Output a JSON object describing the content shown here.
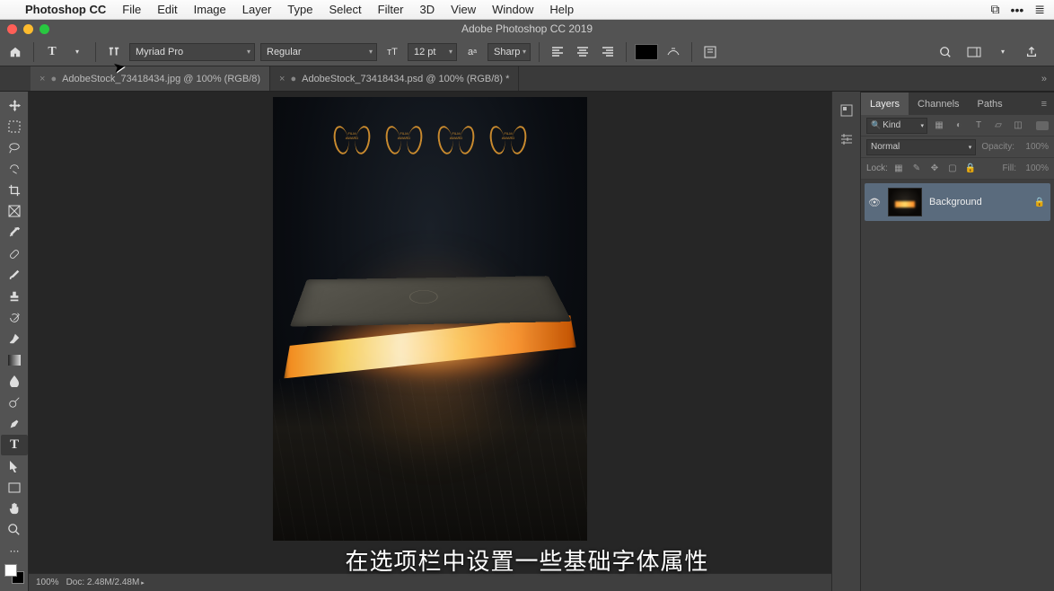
{
  "mac_menu": {
    "app": "Photoshop CC",
    "items": [
      "File",
      "Edit",
      "Image",
      "Layer",
      "Type",
      "Select",
      "Filter",
      "3D",
      "View",
      "Window",
      "Help"
    ]
  },
  "window_title": "Adobe Photoshop CC 2019",
  "options_bar": {
    "font_family": "Myriad Pro",
    "font_style": "Regular",
    "font_size": "12 pt",
    "antialias": "Sharp",
    "color_swatch": "#000000"
  },
  "doc_tabs": [
    {
      "label": "AdobeStock_73418434.jpg @ 100% (RGB/8)",
      "active": true
    },
    {
      "label": "AdobeStock_73418434.psd @ 100% (RGB/8) *",
      "active": false
    }
  ],
  "status_bar": {
    "zoom": "100%",
    "doc_info": "Doc: 2.48M/2.48M"
  },
  "layers_panel": {
    "tabs": [
      "Layers",
      "Channels",
      "Paths"
    ],
    "active_tab": 0,
    "filter_kind": "Kind",
    "blend_mode": "Normal",
    "opacity_label": "Opacity:",
    "opacity_value": "100%",
    "lock_label": "Lock:",
    "fill_label": "Fill:",
    "fill_value": "100%",
    "layers": [
      {
        "name": "Background",
        "locked": true,
        "visible": true
      }
    ]
  },
  "subtitle_text": "在选项栏中设置一些基础字体属性",
  "dirty_marker": "●",
  "close_marker": "×"
}
